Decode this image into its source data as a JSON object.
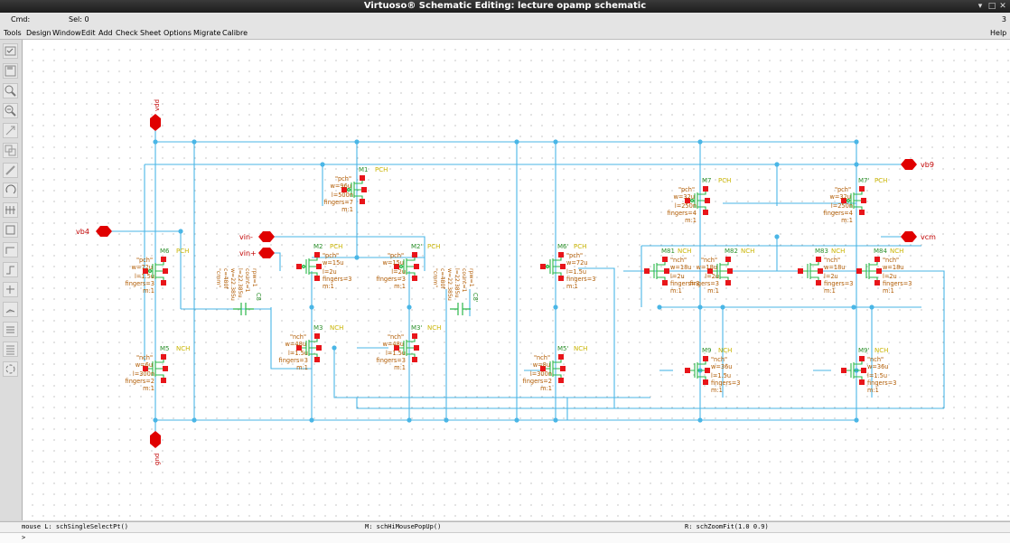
{
  "window": {
    "title": "Virtuoso® Schematic Editing: lecture opamp schematic"
  },
  "status": {
    "cmd": "Cmd:",
    "sel": "Sel: 0",
    "num": "3"
  },
  "menu": {
    "items": [
      "Tools",
      "Design",
      "Window",
      "Edit",
      "Add",
      "Check",
      "Sheet",
      "Options",
      "Migrate",
      "Calibre"
    ],
    "help": "Help"
  },
  "toolbar": {
    "icons": [
      "check-save-icon",
      "save-icon",
      "zoom-in-icon",
      "zoom-out-icon",
      "stretch-icon",
      "copy-icon",
      "delete-icon",
      "undo-icon",
      "add-instance-icon",
      "add-wire-icon",
      "add-pin-icon",
      "add-label-icon",
      "add-net-icon",
      "hierarchy-icon",
      "descend-icon",
      "properties-icon",
      "redo-icon"
    ]
  },
  "pins": {
    "vdd": "vdd",
    "gnd": "gnd",
    "vb4": "vb4",
    "vin_minus": "vin-",
    "vin_plus": "vin+",
    "vb9": "vb9",
    "vcm": "vcm"
  },
  "devices": [
    {
      "name": "M6",
      "type": "PCH",
      "lines": [
        "\"pch\"",
        "w=72u",
        "l=1.5u",
        "fingers=3",
        "m:1"
      ]
    },
    {
      "name": "M5",
      "type": "NCH",
      "lines": [
        "\"nch\"",
        "w=6u",
        "l=300n",
        "fingers=2",
        "m:1"
      ]
    },
    {
      "name": "M1",
      "type": "PCH",
      "lines": [
        "\"pch\"",
        "w=96u",
        "l=500n",
        "fingers=7",
        "m:1"
      ]
    },
    {
      "name": "M2",
      "type": "PCH",
      "lines": [
        "\"pch\"",
        "w=15u",
        "l=2u",
        "fingers=3",
        "m:1"
      ]
    },
    {
      "name": "M2'",
      "type": "PCH",
      "lines": [
        "\"pch\"",
        "w=15u",
        "l=2u",
        "fingers=3",
        "m:1"
      ]
    },
    {
      "name": "M3",
      "type": "NCH",
      "lines": [
        "\"nch\"",
        "w=48u",
        "l=1.5u",
        "fingers=3",
        "m:1"
      ]
    },
    {
      "name": "M3'",
      "type": "NCH",
      "lines": [
        "\"nch\"",
        "w=48u",
        "l=1.5u",
        "fingers=3",
        "m:1"
      ]
    },
    {
      "name": "M6'",
      "type": "PCH",
      "lines": [
        "\"pch\"",
        "w=72u",
        "l=1.5u",
        "fingers=3",
        "m:1"
      ]
    },
    {
      "name": "M5'",
      "type": "NCH",
      "lines": [
        "\"nch\"",
        "w=8u",
        "l=300n",
        "fingers=2",
        "m:1"
      ]
    },
    {
      "name": "M7",
      "type": "PCH",
      "lines": [
        "\"pch\"",
        "w=32u",
        "l=250n",
        "fingers=4",
        "m:1"
      ]
    },
    {
      "name": "M7'",
      "type": "PCH",
      "lines": [
        "\"pch\"",
        "w=32u",
        "l=250n",
        "fingers=4",
        "m:1"
      ]
    },
    {
      "name": "M81",
      "type": "NCH",
      "lines": [
        "\"nch\"",
        "w=18u",
        "l=2u",
        "fingers=3",
        "m:1"
      ]
    },
    {
      "name": "M82",
      "type": "NCH",
      "lines": [
        "\"nch\"",
        "w=18u",
        "l=2u",
        "fingers=3",
        "m:1"
      ]
    },
    {
      "name": "M83",
      "type": "NCH",
      "lines": [
        "\"nch\"",
        "w=18u",
        "l=2u",
        "fingers=3",
        "m:1"
      ]
    },
    {
      "name": "M84",
      "type": "NCH",
      "lines": [
        "\"nch\"",
        "w=18u",
        "l=2u",
        "fingers=3",
        "m:1"
      ]
    },
    {
      "name": "M9",
      "type": "NCH",
      "lines": [
        "\"nch\"",
        "w=36u",
        "l=1.5u",
        "fingers=3",
        "m:1"
      ]
    },
    {
      "name": "M9'",
      "type": "NCH",
      "lines": [
        "\"nch\"",
        "w=36u",
        "l=1.5u",
        "fingers=3",
        "m:1"
      ]
    }
  ],
  "caps": [
    {
      "name": "C8",
      "lines": [
        "\"cmm\"",
        "c=480f",
        "w=22.385u",
        "l=22.385u",
        "count=1",
        "rpw=1"
      ]
    },
    {
      "name": "C8'",
      "lines": [
        "\"cmm\"",
        "c=480f",
        "w=22.385u",
        "l=22.385u",
        "count=1",
        "rpw=1"
      ]
    }
  ],
  "bottom": {
    "left": "mouse L: schSingleSelectPt()",
    "mid": "M: schHiMousePopUp()",
    "right": "R: schZoomFit(1.0 0.9)",
    "prompt": ">"
  }
}
